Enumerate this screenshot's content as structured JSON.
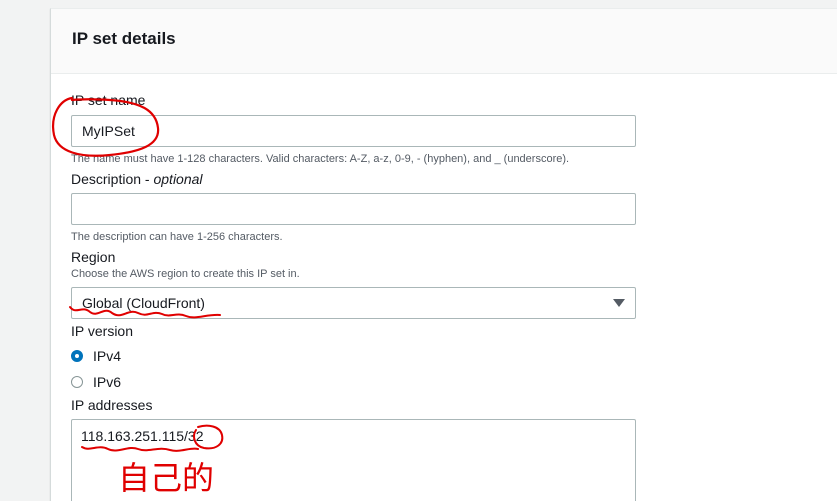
{
  "panel": {
    "title": "IP set details"
  },
  "ip_set_name": {
    "label": "IP set name",
    "value": "MyIPSet",
    "hint": "The name must have 1-128 characters. Valid characters: A-Z, a-z, 0-9, - (hyphen), and _ (underscore)."
  },
  "description": {
    "label": "Description",
    "label_suffix": "optional",
    "separator": " - ",
    "value": "",
    "hint": "The description can have 1-256 characters."
  },
  "region": {
    "label": "Region",
    "hint": "Choose the AWS region to create this IP set in.",
    "selected": "Global (CloudFront)"
  },
  "ip_version": {
    "label": "IP version",
    "options": [
      {
        "label": "IPv4",
        "checked": true
      },
      {
        "label": "IPv6",
        "checked": false
      }
    ]
  },
  "ip_addresses": {
    "label": "IP addresses",
    "value": "118.163.251.115/32"
  },
  "annotations": {
    "handwritten_note": "自己的",
    "ink_color": "#e00000"
  },
  "colors": {
    "accent": "#0073bb",
    "border": "#aab7b8"
  }
}
